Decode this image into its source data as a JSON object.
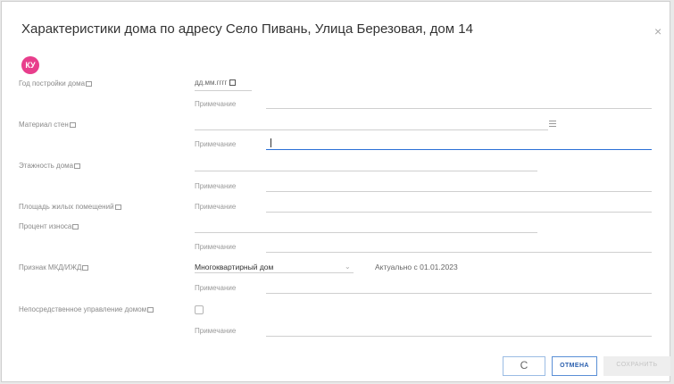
{
  "dialog": {
    "title": "Характеристики дома по адресу Село Пивань, Улица Березовая, дом 14",
    "close_icon": "×",
    "badge": "КУ"
  },
  "note_placeholder": "Примечание",
  "fields": {
    "year_label": "Год постройки дома",
    "year_placeholder": "дд.мм.гггг",
    "material_label": "Материал стен",
    "floors_label": "Этажность дома",
    "area_label": "Площадь жилых помещений",
    "wear_label": "Процент износа",
    "mkd_label": "Признак МКД/ИЖД",
    "mkd_value": "Многоквартирный дом",
    "mkd_actual": "Актуально с 01.01.2023",
    "direct_label": "Непосредственное управление домом"
  },
  "buttons": {
    "reset_icon": "C",
    "cancel": "ОТМЕНА",
    "save": "СОХРАНИТЬ"
  },
  "icons": {
    "close": "close-icon",
    "reset": "refresh-icon",
    "calendar": "calendar-icon",
    "list": "list-icon",
    "chevron": "chevron-down-icon",
    "info": "info-icon"
  },
  "colors": {
    "badge": "#e83e8c",
    "accent": "#2a6fd6"
  }
}
